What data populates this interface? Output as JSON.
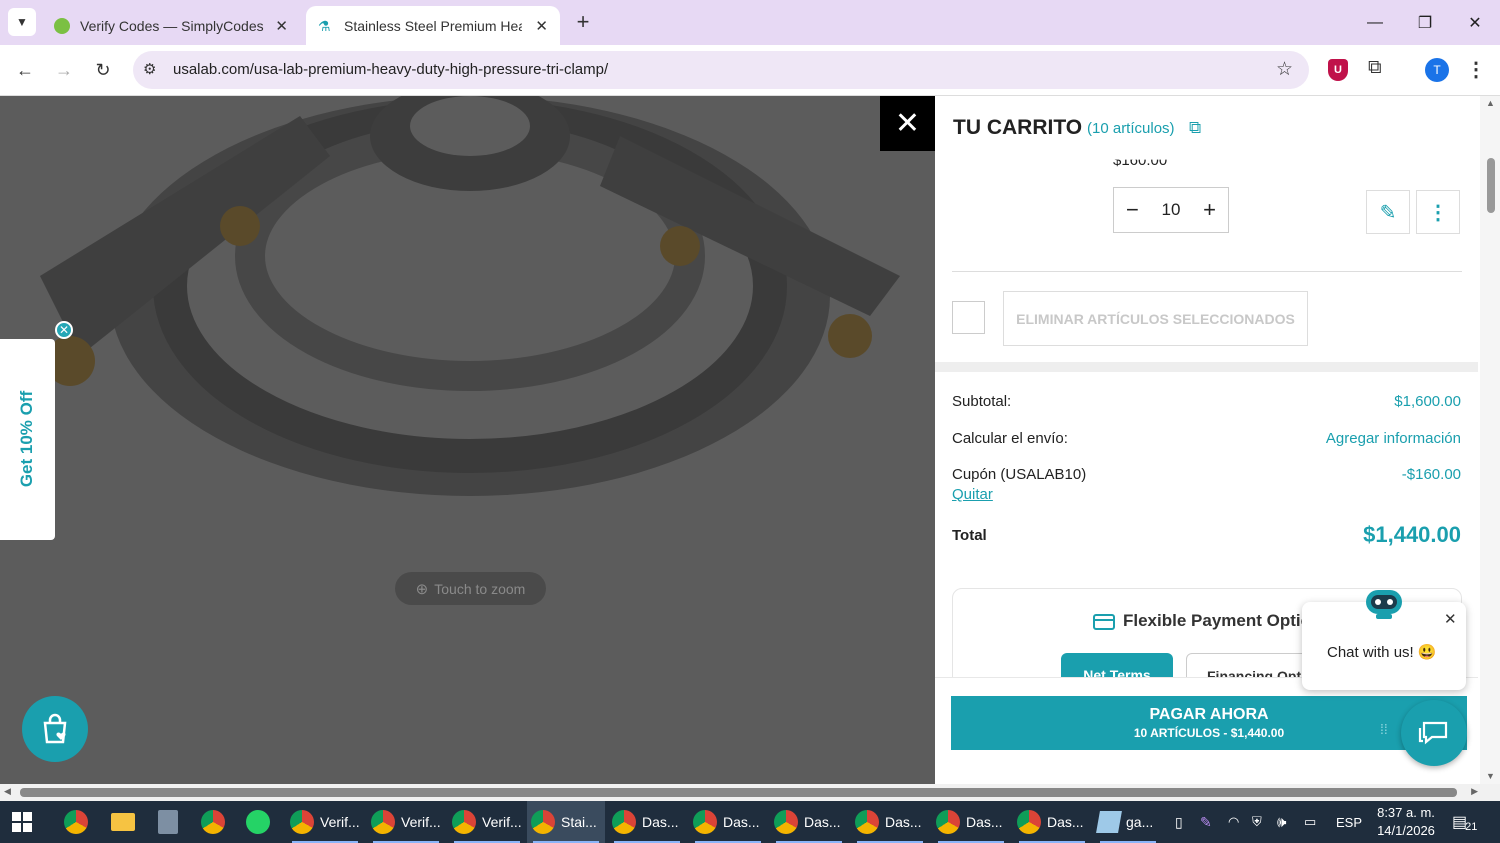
{
  "browser": {
    "tabs": [
      {
        "title": "Verify Codes — SimplyCodes",
        "active": false
      },
      {
        "title": "Stainless Steel Premium Heavy",
        "active": true
      }
    ],
    "url": "usalab.com/usa-lab-premium-heavy-duty-high-pressure-tri-clamp/",
    "profile_initial": "T"
  },
  "viewer": {
    "zoom_hint": "Touch to zoom",
    "promo": "Get 10% Off"
  },
  "cart": {
    "title": "TU CARRITO",
    "count_label": "(10 artículos)",
    "item_price_partial": "$160.00",
    "quantity": "10",
    "delete_selected": "ELIMINAR ARTÍCULOS SELECCIONADOS",
    "subtotal_label": "Subtotal:",
    "subtotal_value": "$1,600.00",
    "shipping_label": "Calcular el envío:",
    "shipping_value": "Agregar información",
    "coupon_label": "Cupón (USALAB10)",
    "coupon_value": "-$160.00",
    "coupon_remove": "Quitar",
    "total_label": "Total",
    "total_value": "$1,440.00",
    "payment_title": "Flexible Payment Optic",
    "payment_tabs": [
      "Net Terms",
      "Financing Opti"
    ],
    "pay_now": "PAGAR AHORA",
    "pay_now_sub": "10 ARTÍCULOS - $1,440.00"
  },
  "chat": {
    "message": "Chat with us! 😃"
  },
  "taskbar": {
    "items": [
      "Verif...",
      "Verif...",
      "Verif...",
      "Stai...",
      "Das...",
      "Das...",
      "Das...",
      "Das...",
      "Das...",
      "Das...",
      "ga..."
    ],
    "language": "ESP",
    "time": "8:37 a. m.",
    "date": "14/1/2026",
    "notification_count": "21"
  },
  "colors": {
    "accent": "#1a9fae",
    "tabstrip": "#e7d9f4",
    "taskbar": "#1f2d3d"
  }
}
